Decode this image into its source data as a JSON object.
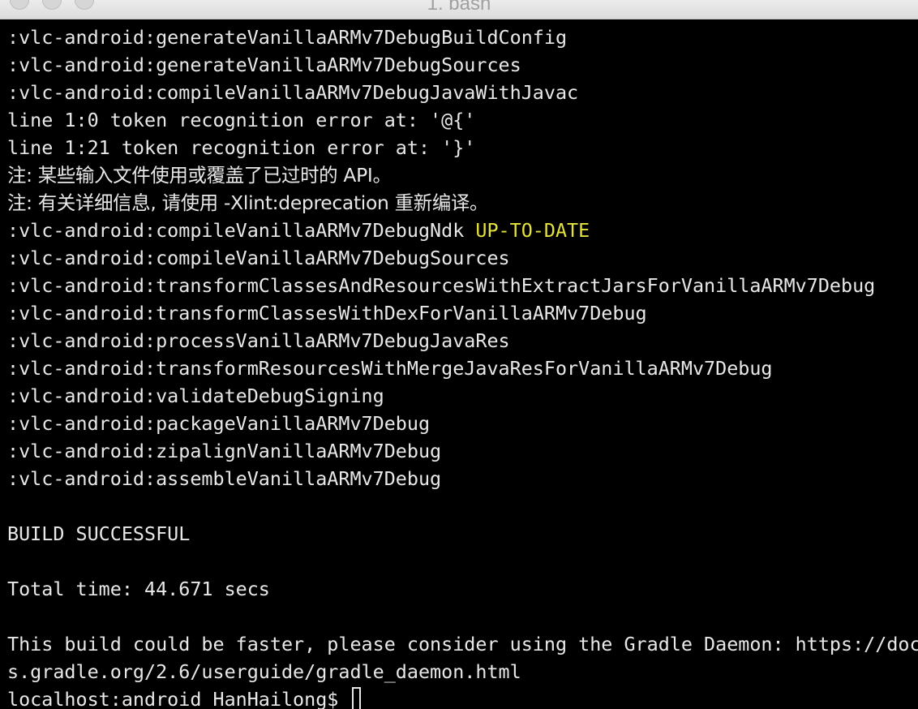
{
  "window": {
    "title": "1. bash"
  },
  "terminal": {
    "lines": [
      ":vlc-android:generateVanillaARMv7DebugBuildConfig",
      ":vlc-android:generateVanillaARMv7DebugSources",
      ":vlc-android:compileVanillaARMv7DebugJavaWithJavac",
      "line 1:0 token recognition error at: '@{'",
      "line 1:21 token recognition error at: '}'",
      "注: 某些输入文件使用或覆盖了已过时的 API。",
      "注: 有关详细信息, 请使用 -Xlint:deprecation 重新编译。",
      ":vlc-android:compileVanillaARMv7DebugNdk ",
      ":vlc-android:compileVanillaARMv7DebugSources",
      ":vlc-android:transformClassesAndResourcesWithExtractJarsForVanillaARMv7Debug",
      ":vlc-android:transformClassesWithDexForVanillaARMv7Debug",
      ":vlc-android:processVanillaARMv7DebugJavaRes",
      ":vlc-android:transformResourcesWithMergeJavaResForVanillaARMv7Debug",
      ":vlc-android:validateDebugSigning",
      ":vlc-android:packageVanillaARMv7Debug",
      ":vlc-android:zipalignVanillaARMv7Debug",
      ":vlc-android:assembleVanillaARMv7Debug",
      "",
      "BUILD SUCCESSFUL",
      "",
      "Total time: 44.671 secs",
      "",
      "This build could be faster, please consider using the Gradle Daemon: https://doc",
      "s.gradle.org/2.6/userguide/gradle_daemon.html"
    ],
    "up_to_date_label": "UP-TO-DATE",
    "prompt": "localhost:android HanHailong$ "
  },
  "colors": {
    "background": "#000000",
    "foreground": "#e8e8e8",
    "up_to_date": "#e5e23a"
  }
}
